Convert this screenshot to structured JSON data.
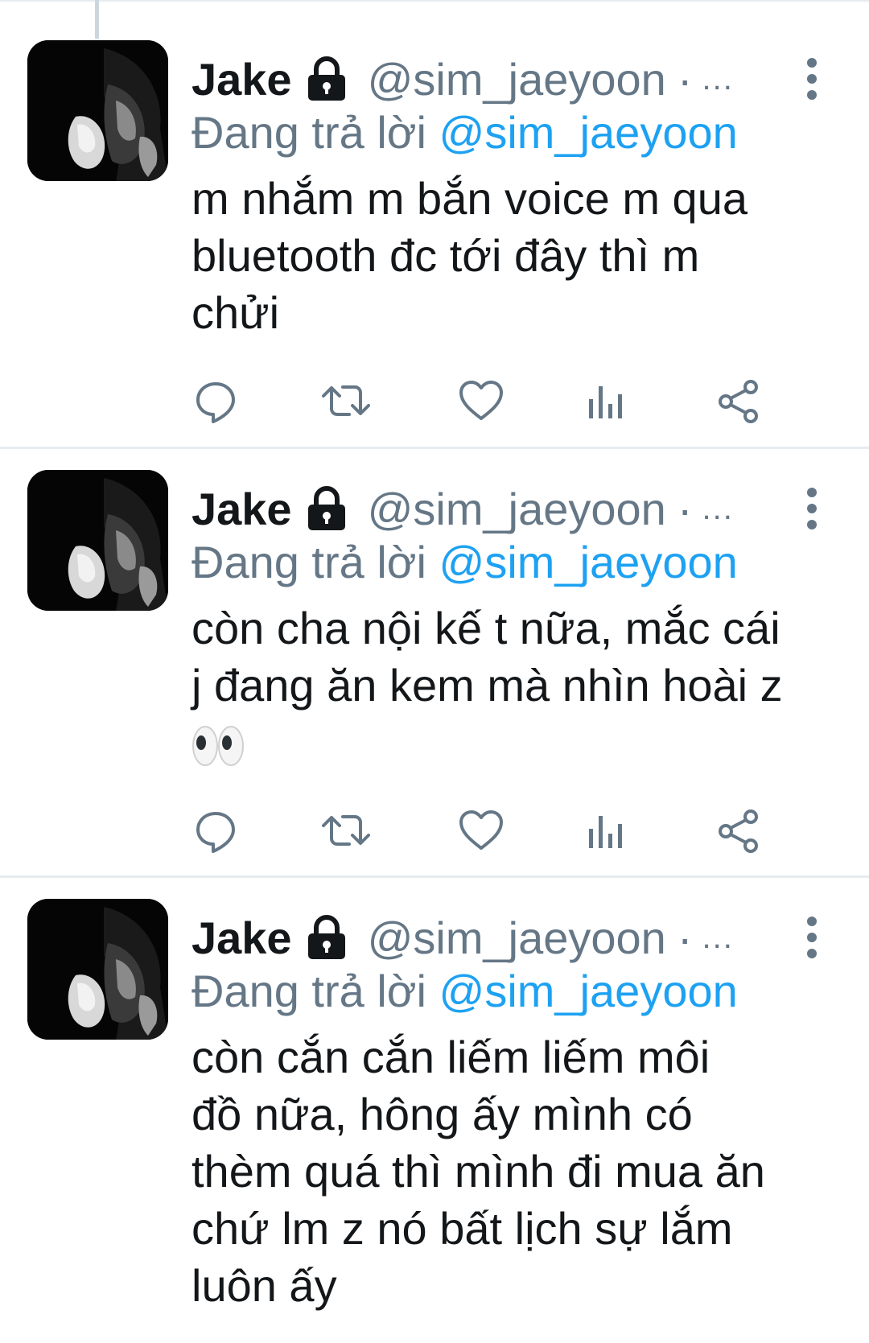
{
  "tweets": [
    {
      "display_name": "Jake",
      "handle": "@sim_jaeyoon",
      "dot": "·",
      "ellipsis": "...",
      "reply_prefix": "Đang trả lời",
      "reply_to": "@sim_jaeyoon",
      "text_lines": [
        "m nhắm m bắn voice m qua",
        "bluetooth đc tới đây thì m",
        "chửi"
      ]
    },
    {
      "display_name": "Jake",
      "handle": "@sim_jaeyoon",
      "dot": "·",
      "ellipsis": "...",
      "reply_prefix": "Đang trả lời",
      "reply_to": "@sim_jaeyoon",
      "text_lines": [
        "còn cha nội kế t nữa, mắc cái",
        "j đang ăn kem mà nhìn hoài z"
      ],
      "emoji": "eyes"
    },
    {
      "display_name": "Jake",
      "handle": "@sim_jaeyoon",
      "dot": "·",
      "ellipsis": "...",
      "reply_prefix": "Đang trả lời",
      "reply_to": "@sim_jaeyoon",
      "text_lines": [
        "còn cắn cắn liếm liếm môi",
        "đồ nữa, hông ấy mình có",
        "thèm quá thì mình đi mua ăn",
        "chứ lm z nó bất lịch sự lắm",
        "luôn ấy"
      ]
    }
  ],
  "icons": {
    "lock": "lock-icon",
    "more": "more-vertical-icon",
    "reply": "reply-icon",
    "retweet": "retweet-icon",
    "like": "heart-icon",
    "analytics": "analytics-icon",
    "share": "share-icon"
  },
  "colors": {
    "link": "#1da1f2",
    "muted": "#657786",
    "text": "#14171a",
    "divider": "#e6ecf0"
  }
}
